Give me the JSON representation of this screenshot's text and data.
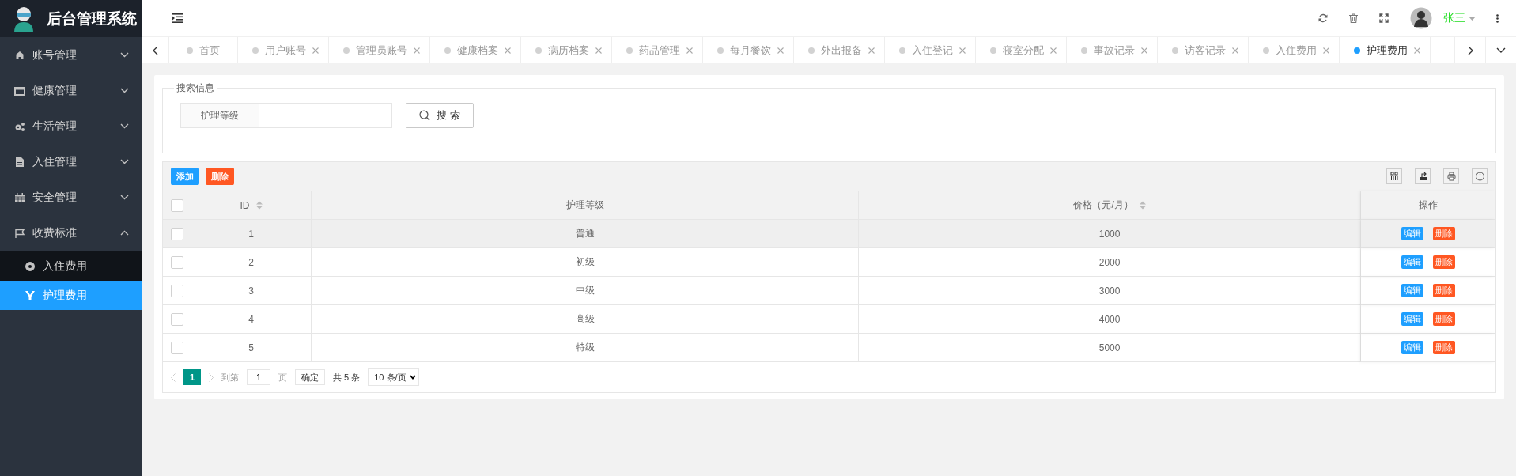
{
  "app": {
    "title": "后台管理系统"
  },
  "sidebar": {
    "items": [
      {
        "label": "账号管理",
        "expanded": false
      },
      {
        "label": "健康管理",
        "expanded": false
      },
      {
        "label": "生活管理",
        "expanded": false
      },
      {
        "label": "入住管理",
        "expanded": false
      },
      {
        "label": "安全管理",
        "expanded": false
      },
      {
        "label": "收费标准",
        "expanded": true,
        "children": [
          {
            "label": "入住费用",
            "selected": false
          },
          {
            "label": "护理费用",
            "selected": true
          }
        ]
      }
    ]
  },
  "header": {
    "user": "张三"
  },
  "tabs": [
    {
      "label": "首页",
      "selected": false,
      "closable": false
    },
    {
      "label": "用户账号",
      "selected": false,
      "closable": true
    },
    {
      "label": "管理员账号",
      "selected": false,
      "closable": true
    },
    {
      "label": "健康档案",
      "selected": false,
      "closable": true
    },
    {
      "label": "病历档案",
      "selected": false,
      "closable": true
    },
    {
      "label": "药品管理",
      "selected": false,
      "closable": true
    },
    {
      "label": "每月餐饮",
      "selected": false,
      "closable": true
    },
    {
      "label": "外出报备",
      "selected": false,
      "closable": true
    },
    {
      "label": "入住登记",
      "selected": false,
      "closable": true
    },
    {
      "label": "寝室分配",
      "selected": false,
      "closable": true
    },
    {
      "label": "事故记录",
      "selected": false,
      "closable": true
    },
    {
      "label": "访客记录",
      "selected": false,
      "closable": true
    },
    {
      "label": "入住费用",
      "selected": false,
      "closable": true
    },
    {
      "label": "护理费用",
      "selected": true,
      "closable": true
    }
  ],
  "search": {
    "legend": "搜索信息",
    "field_label": "护理等级",
    "button": "搜 索"
  },
  "toolbar": [
    {
      "label": "添加",
      "kind": "primary"
    },
    {
      "label": "删除",
      "kind": "danger"
    }
  ],
  "table": {
    "all_checked": false,
    "columns": [
      {
        "label": "ID",
        "sortable": true
      },
      {
        "label": "护理等级",
        "sortable": false
      },
      {
        "label": "价格（元/月）",
        "sortable": true
      },
      {
        "label": "操作",
        "sortable": false
      }
    ],
    "rows": [
      {
        "checked": false,
        "hovered": true,
        "id": "1",
        "level": "普通",
        "price": "1000",
        "actions": [
          {
            "label": "编辑",
            "kind": "primary"
          },
          {
            "label": "删除",
            "kind": "danger"
          }
        ]
      },
      {
        "checked": false,
        "hovered": false,
        "id": "2",
        "level": "初级",
        "price": "2000",
        "actions": [
          {
            "label": "编辑",
            "kind": "primary"
          },
          {
            "label": "删除",
            "kind": "danger"
          }
        ]
      },
      {
        "checked": false,
        "hovered": false,
        "id": "3",
        "level": "中级",
        "price": "3000",
        "actions": [
          {
            "label": "编辑",
            "kind": "primary"
          },
          {
            "label": "删除",
            "kind": "danger"
          }
        ]
      },
      {
        "checked": false,
        "hovered": false,
        "id": "4",
        "level": "高级",
        "price": "4000",
        "actions": [
          {
            "label": "编辑",
            "kind": "primary"
          },
          {
            "label": "删除",
            "kind": "danger"
          }
        ]
      },
      {
        "checked": false,
        "hovered": false,
        "id": "5",
        "level": "特级",
        "price": "5000",
        "actions": [
          {
            "label": "编辑",
            "kind": "primary"
          },
          {
            "label": "删除",
            "kind": "danger"
          }
        ]
      }
    ]
  },
  "pager": {
    "pages": [
      {
        "label": "1",
        "selected": true
      }
    ],
    "goto_label": "到第",
    "goto_value": "1",
    "page_unit": "页",
    "confirm": "确定",
    "total": "共 5 条",
    "page_size": "10 条/页"
  }
}
